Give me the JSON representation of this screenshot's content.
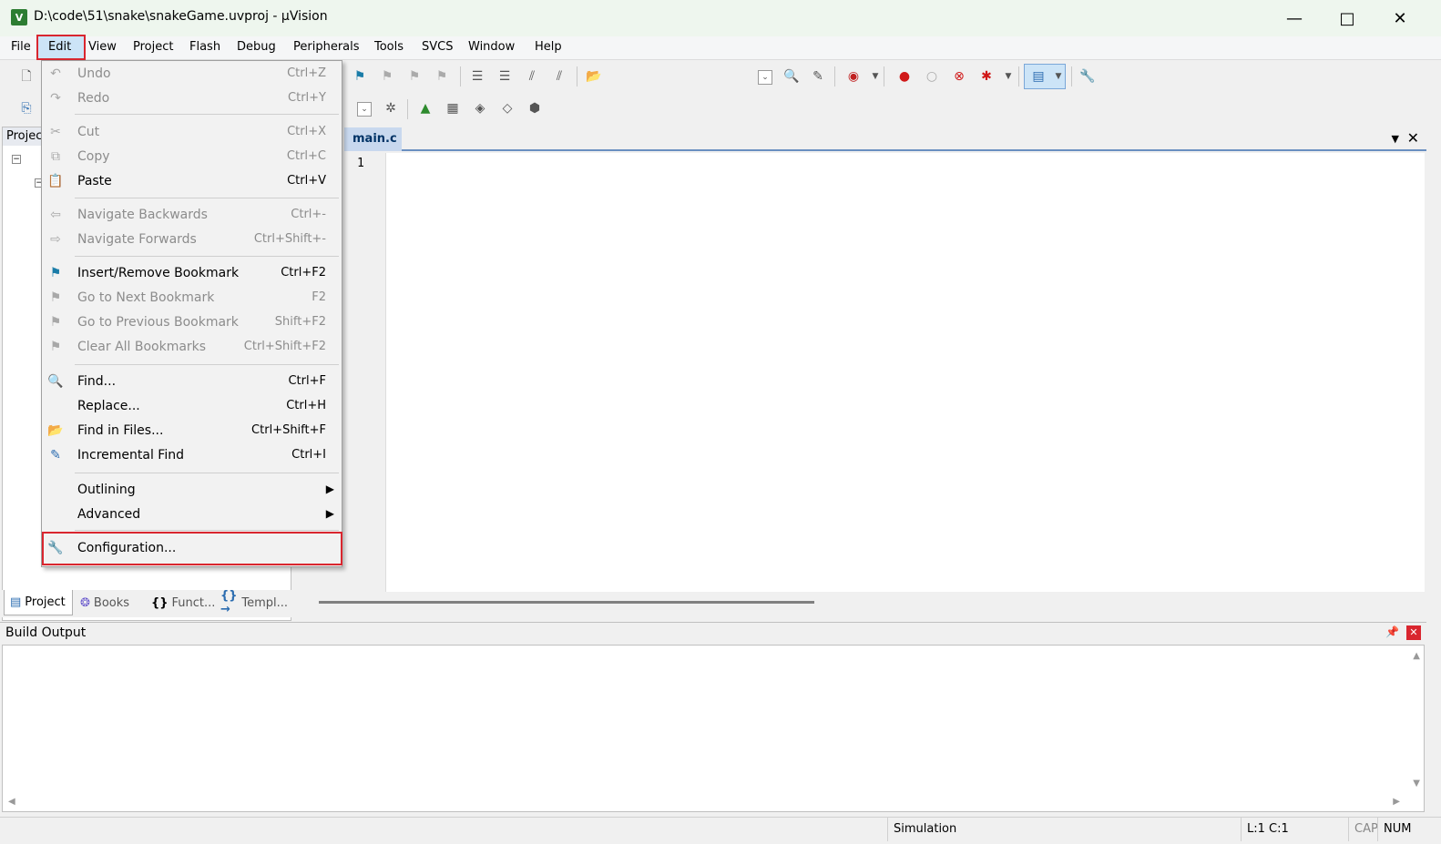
{
  "window": {
    "title": "D:\\code\\51\\snake\\snakeGame.uvproj - µVision",
    "app_icon_glyph": "V",
    "minimize_glyph": "—",
    "maximize_glyph": "□",
    "close_glyph": "✕"
  },
  "menubar": {
    "file": "File",
    "edit": "Edit",
    "view": "View",
    "project": "Project",
    "flash": "Flash",
    "debug": "Debug",
    "peripherals": "Peripherals",
    "tools": "Tools",
    "svcs": "SVCS",
    "window": "Window",
    "help": "Help"
  },
  "edit_menu": {
    "undo": {
      "label": "Undo",
      "shortcut": "Ctrl+Z"
    },
    "redo": {
      "label": "Redo",
      "shortcut": "Ctrl+Y"
    },
    "cut": {
      "label": "Cut",
      "shortcut": "Ctrl+X"
    },
    "copy": {
      "label": "Copy",
      "shortcut": "Ctrl+C"
    },
    "paste": {
      "label": "Paste",
      "shortcut": "Ctrl+V"
    },
    "nav_back": {
      "label": "Navigate Backwards",
      "shortcut": "Ctrl+-"
    },
    "nav_fwd": {
      "label": "Navigate Forwards",
      "shortcut": "Ctrl+Shift+-"
    },
    "bookmark_toggle": {
      "label": "Insert/Remove Bookmark",
      "shortcut": "Ctrl+F2"
    },
    "bookmark_next": {
      "label": "Go to Next Bookmark",
      "shortcut": "F2"
    },
    "bookmark_prev": {
      "label": "Go to Previous Bookmark",
      "shortcut": "Shift+F2"
    },
    "bookmark_clear": {
      "label": "Clear All Bookmarks",
      "shortcut": "Ctrl+Shift+F2"
    },
    "find": {
      "label": "Find...",
      "shortcut": "Ctrl+F"
    },
    "replace": {
      "label": "Replace...",
      "shortcut": "Ctrl+H"
    },
    "find_in_files": {
      "label": "Find in Files...",
      "shortcut": "Ctrl+Shift+F"
    },
    "incremental_find": {
      "label": "Incremental Find",
      "shortcut": "Ctrl+I"
    },
    "outlining": {
      "label": "Outlining"
    },
    "advanced": {
      "label": "Advanced"
    },
    "configuration": {
      "label": "Configuration..."
    }
  },
  "project_pane": {
    "header": "Projec",
    "tabs": {
      "project": "Project",
      "books": "Books",
      "functions": "Funct...",
      "templates": "Templ..."
    }
  },
  "editor": {
    "tab": "main.c",
    "line_number": "1"
  },
  "build_output": {
    "title": "Build Output"
  },
  "status_bar": {
    "mode": "Simulation",
    "position": "L:1 C:1",
    "cap": "CAP",
    "num": "NUM"
  },
  "colors": {
    "highlight_box": "#d9262f",
    "menu_selected": "#cce4f7",
    "title_bar": "#eef6ee"
  }
}
